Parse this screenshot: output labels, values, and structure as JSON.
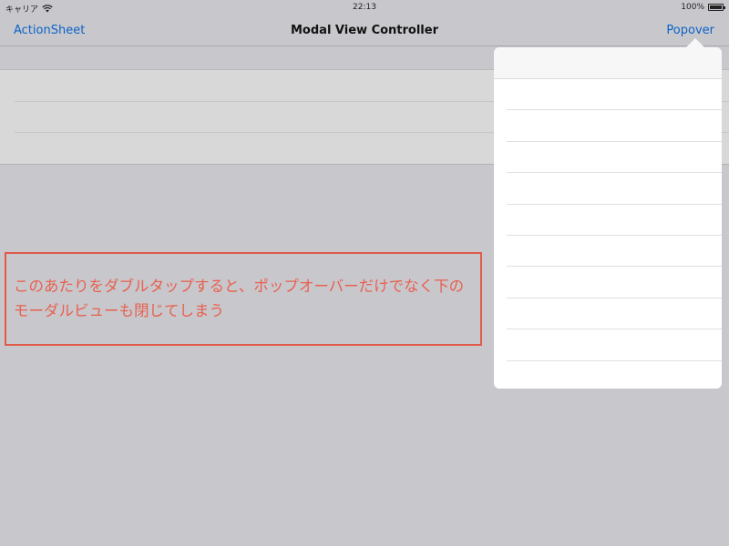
{
  "status_bar": {
    "carrier": "キャリア",
    "time": "22:13",
    "battery": "100%"
  },
  "nav": {
    "left_button": "ActionSheet",
    "title": "Modal View Controller",
    "right_button": "Popover"
  },
  "annotation": {
    "text": "このあたりをダブルタップすると、ポップオーバーだけでなく下のモーダルビューも閉じてしまう"
  }
}
